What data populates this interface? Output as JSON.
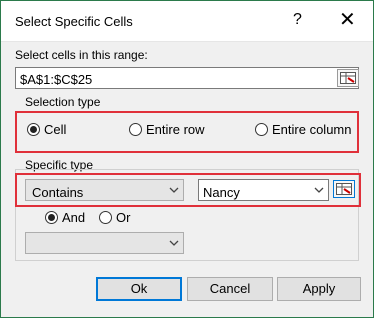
{
  "window": {
    "title": "Select Specific Cells",
    "help_glyph": "?",
    "close_glyph": "✕"
  },
  "range": {
    "label": "Select cells in this range:",
    "value": "$A$1:$C$25"
  },
  "selection_type": {
    "label": "Selection type",
    "options": [
      "Cell",
      "Entire row",
      "Entire column"
    ],
    "selected": "Cell"
  },
  "specific_type": {
    "label": "Specific type",
    "operator": "Contains",
    "value": "Nancy",
    "logic": {
      "and": "And",
      "or": "Or",
      "selected": "And"
    },
    "second_operator": ""
  },
  "buttons": {
    "ok": "Ok",
    "cancel": "Cancel",
    "apply": "Apply"
  },
  "colors": {
    "highlight": "#e0303a",
    "accent": "#0078d7"
  }
}
